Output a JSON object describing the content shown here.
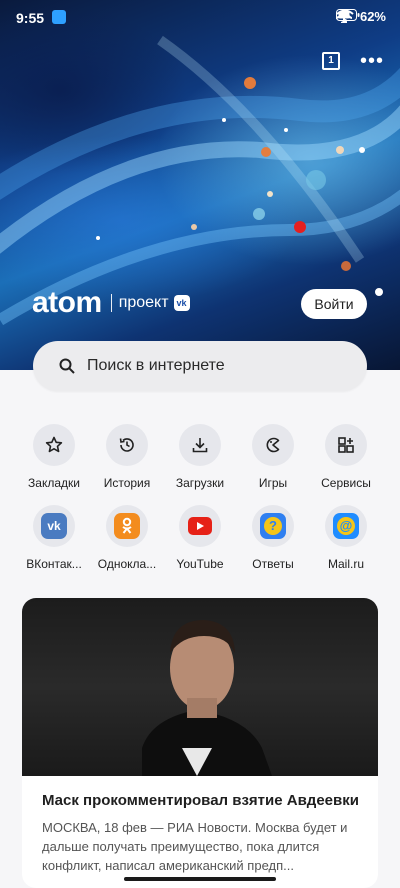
{
  "status": {
    "time": "9:55",
    "battery": "62%",
    "icons": [
      "airplane-icon",
      "wifi-icon",
      "battery-icon"
    ]
  },
  "toolbar": {
    "tabs_count": "1",
    "more_icon": "more-icon"
  },
  "brand": {
    "logo": "atom",
    "project": "проект",
    "vk": "vk"
  },
  "login_label": "Войти",
  "search": {
    "placeholder": "Поиск в интернете"
  },
  "quick_actions": [
    {
      "label": "Закладки",
      "icon": "star-icon"
    },
    {
      "label": "История",
      "icon": "history-icon"
    },
    {
      "label": "Загрузки",
      "icon": "download-icon"
    },
    {
      "label": "Игры",
      "icon": "games-icon"
    },
    {
      "label": "Сервисы",
      "icon": "services-icon"
    }
  ],
  "sites": [
    {
      "label": "ВКонтак...",
      "icon": "vk-icon",
      "color": "#4a7bc1"
    },
    {
      "label": "Однокла...",
      "icon": "ok-icon",
      "color": "#f38c1e"
    },
    {
      "label": "YouTube",
      "icon": "youtube-icon",
      "color": "#e62117"
    },
    {
      "label": "Ответы",
      "icon": "answers-icon",
      "color": "#2f7ff0"
    },
    {
      "label": "Mail.ru",
      "icon": "mail-icon",
      "color": "#1f8cff"
    }
  ],
  "news": {
    "title": "Маск прокомментировал взятие Авдеевки",
    "snippet": "МОСКВА, 18 фев — РИА Новости. Москва будет и дальше получать преимущество, пока длится конфликт, написал американский предп..."
  },
  "colors": {
    "accent": "#0f3d86",
    "background": "#f6f6f8"
  }
}
